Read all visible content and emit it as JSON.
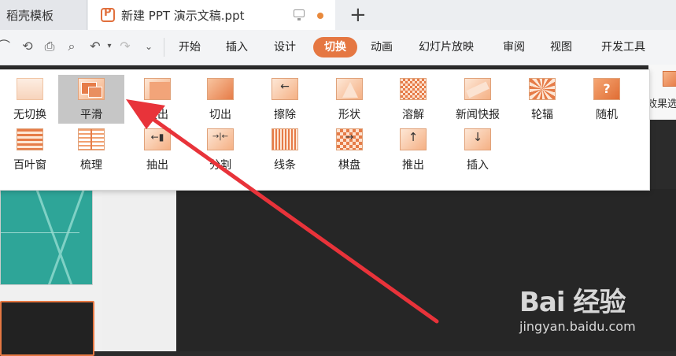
{
  "tabs": [
    {
      "label": "稻壳模板"
    },
    {
      "label": "新建 PPT 演示文稿.ppt"
    }
  ],
  "menu": {
    "items": [
      "开始",
      "插入",
      "设计",
      "切换",
      "动画",
      "幻灯片放映",
      "审阅",
      "视图",
      "开发工具"
    ],
    "active": "切换"
  },
  "ribbon": {
    "effect_options_label": "效果选"
  },
  "gallery": {
    "selected": "平滑",
    "row1": [
      "无切换",
      "平滑",
      "淡出",
      "切出",
      "擦除",
      "形状",
      "溶解",
      "新闻快报",
      "轮辐",
      "随机"
    ],
    "row2": [
      "百叶窗",
      "梳理",
      "抽出",
      "分割",
      "线条",
      "棋盘",
      "推出",
      "插入"
    ]
  },
  "watermark": {
    "brand": "Bai 经验",
    "url": "jingyan.baidu.com"
  },
  "colors": {
    "accent": "#e57742",
    "annotation_arrow": "#e8333a"
  }
}
